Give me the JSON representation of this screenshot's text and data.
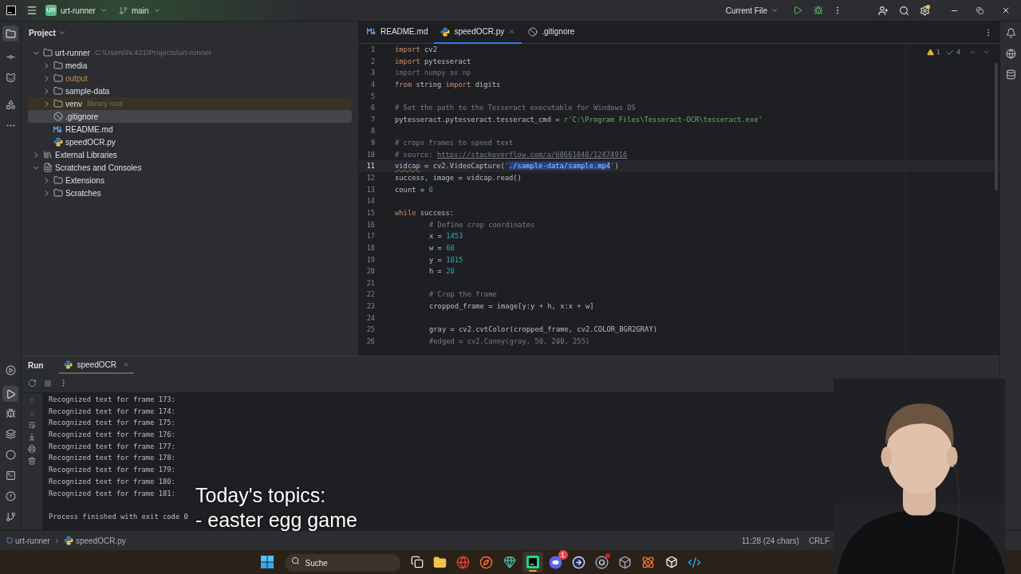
{
  "titlebar": {
    "project_badge": "UR",
    "project": "urt-runner",
    "branch": "main",
    "run_config": "Current File",
    "settings_alert": true
  },
  "project": {
    "title": "Project",
    "tree": [
      {
        "label": "urt-runner",
        "kind": "folder",
        "hint": "C:\\Users\\N.421\\Projects\\urt-runner",
        "expanded": true,
        "selected": false,
        "highlighted": false,
        "excluded": false,
        "children": [
          {
            "label": "media",
            "kind": "folder",
            "expanded": false,
            "selected": false,
            "highlighted": false,
            "excluded": false
          },
          {
            "label": "output",
            "kind": "folder",
            "expanded": false,
            "selected": false,
            "highlighted": false,
            "excluded": true
          },
          {
            "label": "sample-data",
            "kind": "folder",
            "expanded": false,
            "selected": false,
            "highlighted": false,
            "excluded": false
          },
          {
            "label": "venv",
            "kind": "folder",
            "hint": "library root",
            "expanded": false,
            "selected": false,
            "highlighted": true,
            "excluded": false
          },
          {
            "label": ".gitignore",
            "kind": "ignore",
            "selected": true,
            "highlighted": false,
            "excluded": false
          },
          {
            "label": "README.md",
            "kind": "markdown",
            "selected": false,
            "highlighted": false,
            "excluded": false
          },
          {
            "label": "speedOCR.py",
            "kind": "python",
            "selected": false,
            "highlighted": false,
            "excluded": false
          }
        ]
      },
      {
        "label": "External Libraries",
        "kind": "library",
        "expanded": false,
        "selected": false,
        "highlighted": false,
        "excluded": false
      },
      {
        "label": "Scratches and Consoles",
        "kind": "scratches",
        "expanded": true,
        "selected": false,
        "highlighted": false,
        "excluded": false,
        "children": [
          {
            "label": "Extensions",
            "kind": "folder",
            "expanded": false,
            "selected": false,
            "highlighted": false,
            "excluded": false
          },
          {
            "label": "Scratches",
            "kind": "folder",
            "expanded": false,
            "selected": false,
            "highlighted": false,
            "excluded": false
          }
        ]
      }
    ]
  },
  "editor": {
    "tabs": [
      {
        "label": "README.md",
        "kind": "markdown",
        "selected": false
      },
      {
        "label": "speedOCR.py",
        "kind": "python",
        "selected": true
      },
      {
        "label": ".gitignore",
        "kind": "ignore",
        "selected": false
      }
    ],
    "warnings": "1",
    "checks": "4",
    "lines": [
      {
        "number": "1",
        "current": false,
        "tokens": [
          {
            "text": "import",
            "kind": "keyword"
          },
          {
            "text": " cv2",
            "kind": "plain"
          }
        ]
      },
      {
        "number": "2",
        "current": false,
        "tokens": [
          {
            "text": "import",
            "kind": "keyword"
          },
          {
            "text": " pytesseract",
            "kind": "plain"
          }
        ]
      },
      {
        "number": "3",
        "current": false,
        "tokens": [
          {
            "text": "import numpy as np",
            "kind": "unused"
          }
        ]
      },
      {
        "number": "4",
        "current": false,
        "tokens": [
          {
            "text": "from",
            "kind": "keyword"
          },
          {
            "text": " string ",
            "kind": "plain"
          },
          {
            "text": "import",
            "kind": "keyword"
          },
          {
            "text": " digits",
            "kind": "plain"
          }
        ]
      },
      {
        "number": "5",
        "current": false
      },
      {
        "number": "6",
        "current": false,
        "tokens": [
          {
            "text": "# Set the path to the Tesseract executable for Windows OS",
            "kind": "comment"
          }
        ]
      },
      {
        "number": "7",
        "current": false,
        "tokens": [
          {
            "text": "pytesseract.pytesseract.tesseract_cmd = ",
            "kind": "plain"
          },
          {
            "text": "r'C:\\Program Files\\Tesseract-OCR\\tesseract.exe'",
            "kind": "string"
          }
        ]
      },
      {
        "number": "8",
        "current": false
      },
      {
        "number": "9",
        "current": false,
        "tokens": [
          {
            "text": "# crops frames to speed text",
            "kind": "comment"
          }
        ]
      },
      {
        "number": "10",
        "current": false,
        "tokens": [
          {
            "text": "# source: ",
            "kind": "comment"
          },
          {
            "text": "https://stackoverflow.com/a/60661040/12474916",
            "kind": "link"
          }
        ]
      },
      {
        "number": "11",
        "current": true,
        "tokens": [
          {
            "text": "vidcap",
            "kind": "warning"
          },
          {
            "text": " = cv2.VideoCapture(",
            "kind": "plain"
          },
          {
            "text": "'",
            "kind": "string"
          },
          {
            "text": "./sample-data/sample.mp4",
            "kind": "selection"
          },
          {
            "text": "'",
            "kind": "string"
          },
          {
            "text": ")",
            "kind": "plain"
          }
        ]
      },
      {
        "number": "12",
        "current": false,
        "tokens": [
          {
            "text": "success, image = vidcap.read()",
            "kind": "plain"
          }
        ]
      },
      {
        "number": "13",
        "current": false,
        "tokens": [
          {
            "text": "count = ",
            "kind": "plain"
          },
          {
            "text": "0",
            "kind": "number"
          }
        ]
      },
      {
        "number": "14",
        "current": false
      },
      {
        "number": "15",
        "current": false,
        "tokens": [
          {
            "text": "while",
            "kind": "keyword"
          },
          {
            "text": " success:",
            "kind": "plain"
          }
        ]
      },
      {
        "number": "16",
        "current": false,
        "indented": true,
        "tokens": [
          {
            "text": "# Define crop coordinates",
            "kind": "comment"
          }
        ]
      },
      {
        "number": "17",
        "current": false,
        "indented": true,
        "tokens": [
          {
            "text": "x = ",
            "kind": "plain"
          },
          {
            "text": "1453",
            "kind": "number"
          }
        ]
      },
      {
        "number": "18",
        "current": false,
        "indented": true,
        "tokens": [
          {
            "text": "w = ",
            "kind": "plain"
          },
          {
            "text": "60",
            "kind": "number"
          }
        ]
      },
      {
        "number": "19",
        "current": false,
        "indented": true,
        "tokens": [
          {
            "text": "y = ",
            "kind": "plain"
          },
          {
            "text": "1015",
            "kind": "number"
          }
        ]
      },
      {
        "number": "20",
        "current": false,
        "indented": true,
        "tokens": [
          {
            "text": "h = ",
            "kind": "plain"
          },
          {
            "text": "20",
            "kind": "number"
          }
        ]
      },
      {
        "number": "21",
        "current": false
      },
      {
        "number": "22",
        "current": false,
        "indented": true,
        "tokens": [
          {
            "text": "# Crop the frame",
            "kind": "comment"
          }
        ]
      },
      {
        "number": "23",
        "current": false,
        "indented": true,
        "tokens": [
          {
            "text": "cropped_frame = image[y:y + h, x:x + w]",
            "kind": "plain"
          }
        ]
      },
      {
        "number": "24",
        "current": false
      },
      {
        "number": "25",
        "current": false,
        "indented": true,
        "tokens": [
          {
            "text": "gray = cv2.cvtColor(cropped_frame, cv2.COLOR_BGR2GRAY)",
            "kind": "plain"
          }
        ]
      },
      {
        "number": "26",
        "current": false,
        "indented": true,
        "tokens": [
          {
            "text": "#edged = cv2.Canny(gray, 50, 200, 255)",
            "kind": "comment"
          }
        ]
      }
    ]
  },
  "run": {
    "title": "Run",
    "tabs": [
      {
        "label": "speedOCR",
        "selected": true
      }
    ],
    "output": [
      {
        "text": "Recognized text for frame 173:",
        "kind": "line"
      },
      {
        "text": "Recognized text for frame 174:",
        "kind": "line"
      },
      {
        "text": "Recognized text for frame 175:",
        "kind": "line"
      },
      {
        "text": "Recognized text for frame 176:",
        "kind": "line"
      },
      {
        "text": "Recognized text for frame 177:",
        "kind": "line"
      },
      {
        "text": "Recognized text for frame 178:",
        "kind": "line"
      },
      {
        "text": "Recognized text for frame 179:",
        "kind": "line"
      },
      {
        "text": "Recognized text for frame 180:",
        "kind": "line"
      },
      {
        "text": "Recognized text for frame 181:",
        "kind": "line"
      },
      {
        "text": "Process finished with exit code 0",
        "kind": "status"
      }
    ]
  },
  "caption": [
    "Today's topics:",
    "- easter egg game"
  ],
  "status_bar": {
    "breadcrumbs": [
      {
        "label": "urt-runner",
        "kind": "module"
      },
      {
        "label": "speedOCR.py",
        "kind": "python"
      }
    ],
    "position": "11:28 (24 chars)",
    "line_ending": "CRLF"
  },
  "taskbar": {
    "search": {
      "placeholder": "Suche"
    },
    "apps": [
      {
        "kind": "task-view",
        "active": false,
        "alert": false
      },
      {
        "kind": "explorer",
        "active": false,
        "alert": false
      },
      {
        "kind": "chrome",
        "active": false,
        "alert": false
      },
      {
        "kind": "firefox",
        "active": false,
        "alert": false
      },
      {
        "kind": "gem",
        "active": false,
        "alert": false
      },
      {
        "kind": "ide",
        "active": true,
        "alert": false
      },
      {
        "kind": "chat",
        "active": false,
        "alert": false,
        "badge": "1"
      },
      {
        "kind": "arrow",
        "active": false,
        "alert": false
      },
      {
        "kind": "record",
        "active": false,
        "alert": true
      },
      {
        "kind": "cube",
        "active": false,
        "alert": false
      },
      {
        "kind": "blender",
        "active": false,
        "alert": false
      },
      {
        "kind": "engine",
        "active": false,
        "alert": false
      },
      {
        "kind": "code",
        "active": false,
        "alert": false
      }
    ]
  }
}
